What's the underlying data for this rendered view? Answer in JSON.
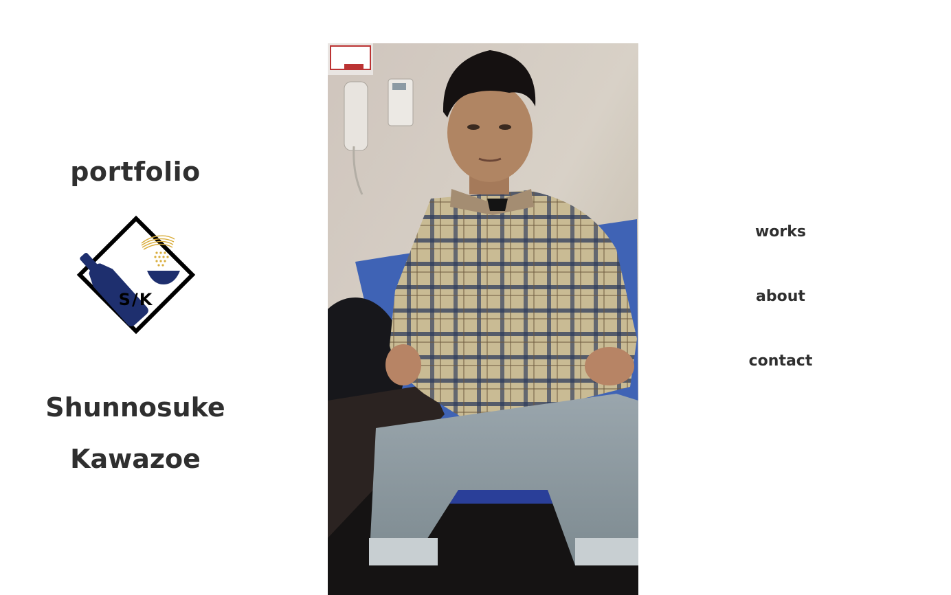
{
  "sidebar": {
    "title": "portfolio",
    "logo_icon": "sake-bottle-rice-bowl-logo-icon",
    "logo_text": "S/K",
    "name_first": "Shunnosuke",
    "name_last": "Kawazoe"
  },
  "main": {
    "photo_icon": "portrait-photo"
  },
  "nav": {
    "items": [
      {
        "label": "works"
      },
      {
        "label": "about"
      },
      {
        "label": "contact"
      }
    ]
  },
  "colors": {
    "text": "#2f2f2f",
    "logo_blue": "#1e2f6e",
    "logo_gold": "#d9ad3c",
    "background": "#ffffff"
  }
}
